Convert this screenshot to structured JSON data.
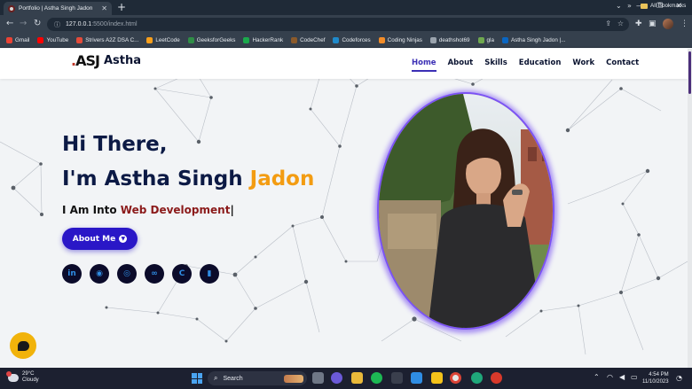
{
  "browser": {
    "tab_title": "Portfolio | Astha Singh Jadon",
    "url_host": "127.0.0.1",
    "url_rest": ":5500/index.html",
    "bookmarks": [
      {
        "label": "Gmail",
        "color": "#ea4335"
      },
      {
        "label": "YouTube",
        "color": "#ff0000"
      },
      {
        "label": "Strivers A2Z DSA C...",
        "color": "#e34b3a"
      },
      {
        "label": "LeetCode",
        "color": "#f89f1b"
      },
      {
        "label": "GeeksforGeeks",
        "color": "#2f8d46"
      },
      {
        "label": "HackerRank",
        "color": "#1ba94c"
      },
      {
        "label": "CodeChef",
        "color": "#8b5a2b"
      },
      {
        "label": "Codeforces",
        "color": "#1f8acb"
      },
      {
        "label": "Coding Ninjas",
        "color": "#f28c28"
      },
      {
        "label": "deathshot69",
        "color": "#9aa3ad"
      },
      {
        "label": "gla",
        "color": "#6fa84f"
      },
      {
        "label": "Astha Singh Jadon |...",
        "color": "#0a66c2"
      }
    ],
    "all_bookmarks": "All Bookmarks"
  },
  "site": {
    "logo_mark": "ASJ",
    "logo_text": "Astha",
    "nav": [
      "Home",
      "About",
      "Skills",
      "Education",
      "Work",
      "Contact"
    ],
    "active_nav": "Home",
    "greeting": "Hi There,",
    "name_prefix": "I'm Astha Singh ",
    "name_highlight": "Jadon",
    "into_prefix": "I Am Into ",
    "into_typed": "Web Development",
    "cursor": "|",
    "about_button": "About Me",
    "socials": [
      "linkedin-icon",
      "github-icon",
      "codechef-icon",
      "leetcode-icon",
      "codeforces-icon",
      "hackerrank-icon"
    ],
    "social_glyphs": [
      "in",
      "◉",
      "◎",
      "∞",
      "C",
      "▮"
    ]
  },
  "taskbar": {
    "temperature": "29°C",
    "weather": "Cloudy",
    "search_placeholder": "Search",
    "time": "4:54 PM",
    "date": "11/10/2023"
  },
  "colors": {
    "accent": "#2a17c7",
    "highlight": "#f39c12",
    "typed": "#8b1a1a",
    "heading": "#0c1a45"
  }
}
